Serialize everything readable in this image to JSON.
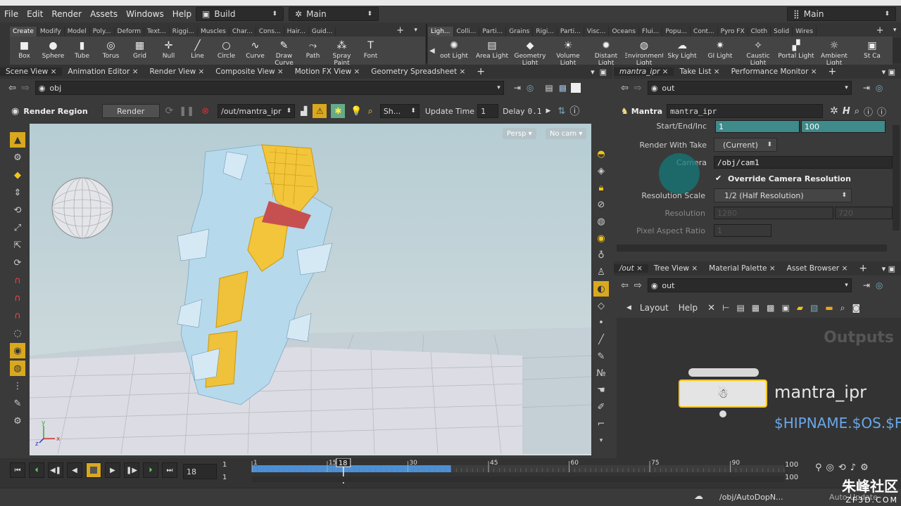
{
  "menu": {
    "items": [
      "File",
      "Edit",
      "Render",
      "Assets",
      "Windows",
      "Help"
    ],
    "desktop": "Build",
    "desktop2": "Main",
    "desktop_right": "Main"
  },
  "shelf_left": {
    "tabs": [
      "Create",
      "Modify",
      "Model",
      "Poly...",
      "Deform",
      "Text...",
      "Riggi...",
      "Muscles",
      "Char...",
      "Cons...",
      "Hair...",
      "Guid..."
    ],
    "tools": [
      {
        "label": "Box",
        "icon": "box-icon",
        "glyph": "■"
      },
      {
        "label": "Sphere",
        "icon": "sphere-icon",
        "glyph": "●"
      },
      {
        "label": "Tube",
        "icon": "tube-icon",
        "glyph": "▮"
      },
      {
        "label": "Torus",
        "icon": "torus-icon",
        "glyph": "◎"
      },
      {
        "label": "Grid",
        "icon": "grid-icon",
        "glyph": "▦"
      },
      {
        "label": "Null",
        "icon": "null-icon",
        "glyph": "✛"
      },
      {
        "label": "Line",
        "icon": "line-icon",
        "glyph": "╱"
      },
      {
        "label": "Circle",
        "icon": "circle-icon",
        "glyph": "○"
      },
      {
        "label": "Curve",
        "icon": "curve-icon",
        "glyph": "∿"
      },
      {
        "label": "Draw Curve",
        "icon": "draw-curve-icon",
        "glyph": "✎"
      },
      {
        "label": "Path",
        "icon": "path-icon",
        "glyph": "⤳"
      },
      {
        "label": "Spray Paint",
        "icon": "spray-paint-icon",
        "glyph": "⁂"
      },
      {
        "label": "Font",
        "icon": "font-icon",
        "glyph": "T"
      }
    ]
  },
  "shelf_right": {
    "tabs": [
      "Ligh...",
      "Colli...",
      "Parti...",
      "Grains",
      "Rigi...",
      "Parti...",
      "Visc...",
      "Oceans",
      "Flui...",
      "Popu...",
      "Cont...",
      "Pyro FX",
      "Cloth",
      "Solid",
      "Wires"
    ],
    "tools": [
      {
        "label": "oot Light",
        "icon": "point-light-icon",
        "glyph": "✺"
      },
      {
        "label": "Area Light",
        "icon": "area-light-icon",
        "glyph": "▤"
      },
      {
        "label": "Geometry Light",
        "icon": "geometry-light-icon",
        "glyph": "◆"
      },
      {
        "label": "Volume Light",
        "icon": "volume-light-icon",
        "glyph": "☀"
      },
      {
        "label": "Distant Light",
        "icon": "distant-light-icon",
        "glyph": "✹"
      },
      {
        "label": "Environment Light",
        "icon": "environment-light-icon",
        "glyph": "◍"
      },
      {
        "label": "Sky Light",
        "icon": "sky-light-icon",
        "glyph": "☁"
      },
      {
        "label": "GI Light",
        "icon": "gi-light-icon",
        "glyph": "✷"
      },
      {
        "label": "Caustic Light",
        "icon": "caustic-light-icon",
        "glyph": "✧"
      },
      {
        "label": "Portal Light",
        "icon": "portal-light-icon",
        "glyph": "▞"
      },
      {
        "label": "Ambient Light",
        "icon": "ambient-light-icon",
        "glyph": "☼"
      },
      {
        "label": "St Ca",
        "icon": "stereo-camera-icon",
        "glyph": "▣"
      }
    ]
  },
  "left_pane": {
    "tabs": [
      "Scene View",
      "Animation Editor",
      "Render View",
      "Composite View",
      "Motion FX View",
      "Geometry Spreadsheet"
    ],
    "path": "obj",
    "render_region": "Render Region",
    "render_button": "Render",
    "rop_path": "/out/mantra_ipr",
    "sh_button": "Sh...",
    "update_time_label": "Update Time",
    "update_time_value": "1",
    "delay_label": "Delay",
    "delay_value": "0.1",
    "persp": "Persp",
    "cam": "No cam"
  },
  "params": {
    "tabs": [
      "mantra_ipr",
      "Take List",
      "Performance Monitor"
    ],
    "path": "out",
    "node_type": "Mantra",
    "node_name": "mantra_ipr",
    "start_end_label": "Start/End/Inc",
    "start": "1",
    "end": "100",
    "take_label": "Render With Take",
    "take_value": "(Current)",
    "camera_label": "Camera",
    "camera_value": "/obj/cam1",
    "override_label": "Override Camera Resolution",
    "res_scale_label": "Resolution Scale",
    "res_scale_value": "1/2 (Half Resolution)",
    "resolution_label": "Resolution",
    "res_x": "1280",
    "res_y": "720",
    "pixel_aspect_label": "Pixel Aspect Ratio",
    "pixel_aspect_value": "1"
  },
  "network": {
    "tabs": [
      "/out",
      "Tree View",
      "Material Palette",
      "Asset Browser"
    ],
    "path": "out",
    "layout": "Layout",
    "help": "Help",
    "context_label": "Outputs",
    "node_name": "mantra_ipr",
    "node_output": "$HIPNAME.$OS.$F"
  },
  "timeline": {
    "frame": "18",
    "start": "1",
    "start2": "1",
    "end": "100",
    "end2": "100",
    "range_end": 100,
    "current": 18,
    "playbar_label": "18",
    "ticks": [
      {
        "v": 1,
        "label": "1"
      },
      {
        "v": 15,
        "label": "15"
      },
      {
        "v": 30,
        "label": "30"
      },
      {
        "v": 45,
        "label": "45"
      },
      {
        "v": 60,
        "label": "60"
      },
      {
        "v": 75,
        "label": "75"
      },
      {
        "v": 90,
        "label": "90"
      }
    ],
    "cached_to": 30
  },
  "status": {
    "path": "/obj/AutoDopN...",
    "auto_update": "Auto Update",
    "watermark": "朱峰社区",
    "watermark_url": "ZF3D.COM"
  },
  "colors": {
    "accent": "#f5c518",
    "teal": "#3f8a8a",
    "sky_top": "#b5cdd3",
    "ground": "#c7cdd4",
    "cache_blue": "#4a90d8"
  }
}
